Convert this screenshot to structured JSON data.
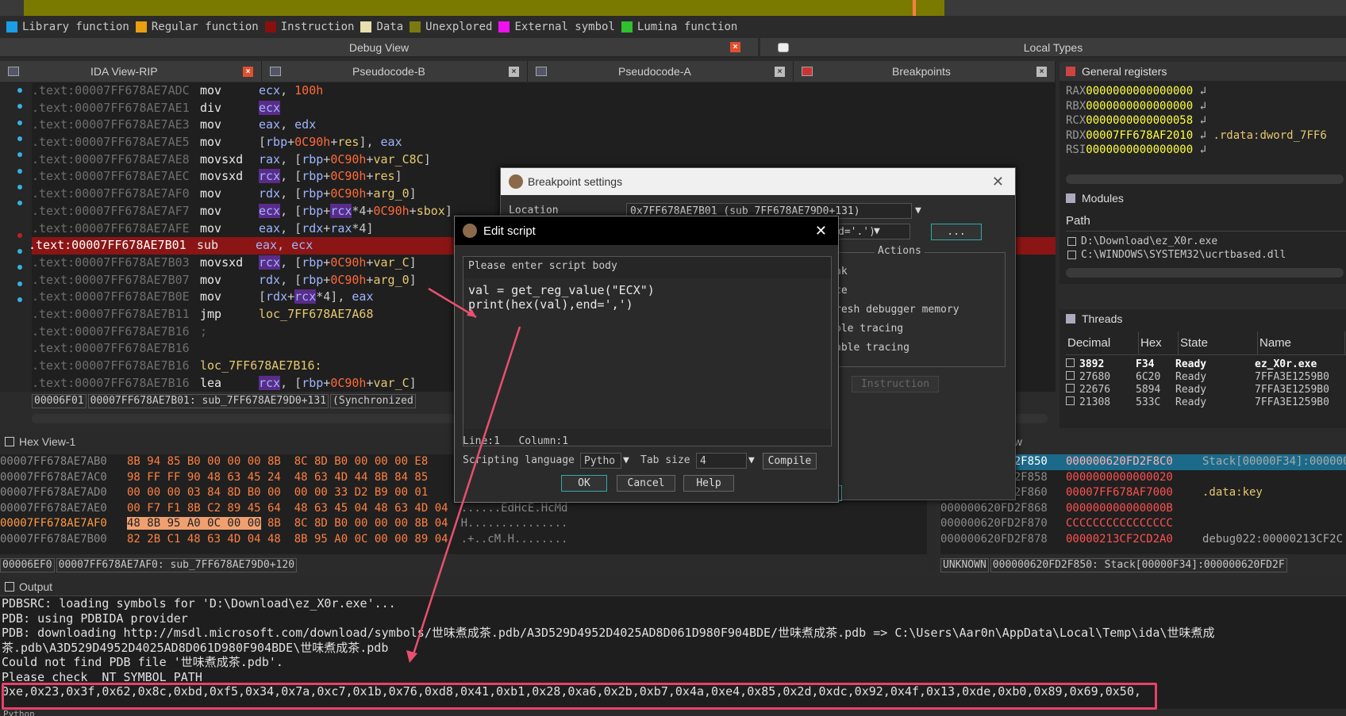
{
  "legend": [
    {
      "label": "Library function",
      "color": "#1a9ee8"
    },
    {
      "label": "Regular function",
      "color": "#e8a010"
    },
    {
      "label": "Instruction",
      "color": "#8a1010"
    },
    {
      "label": "Data",
      "color": "#e8e0b0"
    },
    {
      "label": "Unexplored",
      "color": "#7a7a10"
    },
    {
      "label": "External symbol",
      "color": "#f010f0"
    },
    {
      "label": "Lumina function",
      "color": "#30c030"
    }
  ],
  "panels": {
    "debug_view": "Debug View",
    "local_types": "Local Types",
    "tabs": [
      "IDA View-RIP",
      "Pseudocode-B",
      "Pseudocode-A",
      "Breakpoints"
    ],
    "general_registers": "General registers",
    "modules": "Modules",
    "modules_path": "Path",
    "threads": "Threads",
    "hex_view": "Hex View-1",
    "output": "Output",
    "stack_view_suffix": "ew"
  },
  "disasm": [
    {
      "addr": ".text:00007FF678AE7ADC",
      "mn": "mov",
      "ops": [
        [
          "reg",
          "ecx"
        ],
        [
          "txt",
          ", "
        ],
        [
          "num",
          "100h"
        ]
      ]
    },
    {
      "addr": ".text:00007FF678AE7AE1",
      "mn": "div",
      "ops": [
        [
          "reghl",
          "ecx"
        ]
      ]
    },
    {
      "addr": ".text:00007FF678AE7AE3",
      "mn": "mov",
      "ops": [
        [
          "reg",
          "eax"
        ],
        [
          "txt",
          ", "
        ],
        [
          "reg",
          "edx"
        ]
      ]
    },
    {
      "addr": ".text:00007FF678AE7AE5",
      "mn": "mov",
      "ops": [
        [
          "txt",
          "["
        ],
        [
          "reg",
          "rbp"
        ],
        [
          "txt",
          "+"
        ],
        [
          "num",
          "0C90h"
        ],
        [
          "txt",
          "+"
        ],
        [
          "ident",
          "res"
        ],
        [
          "txt",
          "], "
        ],
        [
          "reg",
          "eax"
        ]
      ]
    },
    {
      "addr": ".text:00007FF678AE7AE8",
      "mn": "movsxd",
      "ops": [
        [
          "reg",
          "rax"
        ],
        [
          "txt",
          ", ["
        ],
        [
          "reg",
          "rbp"
        ],
        [
          "txt",
          "+"
        ],
        [
          "num",
          "0C90h"
        ],
        [
          "txt",
          "+"
        ],
        [
          "ident",
          "var_C8C"
        ],
        [
          "txt",
          "]"
        ]
      ]
    },
    {
      "addr": ".text:00007FF678AE7AEC",
      "mn": "movsxd",
      "ops": [
        [
          "reghl",
          "rcx"
        ],
        [
          "txt",
          ", ["
        ],
        [
          "reg",
          "rbp"
        ],
        [
          "txt",
          "+"
        ],
        [
          "num",
          "0C90h"
        ],
        [
          "txt",
          "+"
        ],
        [
          "ident",
          "res"
        ],
        [
          "txt",
          "]"
        ]
      ]
    },
    {
      "addr": ".text:00007FF678AE7AF0",
      "mn": "mov",
      "ops": [
        [
          "reg",
          "rdx"
        ],
        [
          "txt",
          ", ["
        ],
        [
          "reg",
          "rbp"
        ],
        [
          "txt",
          "+"
        ],
        [
          "num",
          "0C90h"
        ],
        [
          "txt",
          "+"
        ],
        [
          "ident",
          "arg_0"
        ],
        [
          "txt",
          "]"
        ]
      ]
    },
    {
      "addr": ".text:00007FF678AE7AF7",
      "mn": "mov",
      "ops": [
        [
          "reghl",
          "ecx"
        ],
        [
          "txt",
          ", ["
        ],
        [
          "reg",
          "rbp"
        ],
        [
          "txt",
          "+"
        ],
        [
          "reghl",
          "rcx"
        ],
        [
          "txt",
          "*4+"
        ],
        [
          "num",
          "0C90h"
        ],
        [
          "txt",
          "+"
        ],
        [
          "ident",
          "sbox"
        ],
        [
          "txt",
          "]"
        ]
      ]
    },
    {
      "addr": ".text:00007FF678AE7AFE",
      "mn": "mov",
      "ops": [
        [
          "reg",
          "eax"
        ],
        [
          "txt",
          ", ["
        ],
        [
          "reg",
          "rdx"
        ],
        [
          "txt",
          "+"
        ],
        [
          "reg",
          "rax"
        ],
        [
          "txt",
          "*4]"
        ]
      ]
    },
    {
      "addr": ".text:00007FF678AE7B01",
      "mn": "sub",
      "ops": [
        [
          "reg",
          "eax"
        ],
        [
          "txt",
          ", "
        ],
        [
          "reg",
          "ecx"
        ]
      ],
      "hl": true
    },
    {
      "addr": ".text:00007FF678AE7B03",
      "mn": "movsxd",
      "ops": [
        [
          "reghl",
          "rcx"
        ],
        [
          "txt",
          ", ["
        ],
        [
          "reg",
          "rbp"
        ],
        [
          "txt",
          "+"
        ],
        [
          "num",
          "0C90h"
        ],
        [
          "txt",
          "+"
        ],
        [
          "ident",
          "var_C"
        ],
        [
          "txt",
          "]"
        ]
      ]
    },
    {
      "addr": ".text:00007FF678AE7B07",
      "mn": "mov",
      "ops": [
        [
          "reg",
          "rdx"
        ],
        [
          "txt",
          ", ["
        ],
        [
          "reg",
          "rbp"
        ],
        [
          "txt",
          "+"
        ],
        [
          "num",
          "0C90h"
        ],
        [
          "txt",
          "+"
        ],
        [
          "ident",
          "arg_0"
        ],
        [
          "txt",
          "]"
        ]
      ]
    },
    {
      "addr": ".text:00007FF678AE7B0E",
      "mn": "mov",
      "ops": [
        [
          "txt",
          "["
        ],
        [
          "reg",
          "rdx"
        ],
        [
          "txt",
          "+"
        ],
        [
          "reghl",
          "rcx"
        ],
        [
          "txt",
          "*4], "
        ],
        [
          "reg",
          "eax"
        ]
      ]
    },
    {
      "addr": ".text:00007FF678AE7B11",
      "mn": "jmp",
      "ops": [
        [
          "ident",
          "loc_7FF678AE7A68"
        ]
      ]
    },
    {
      "addr": ".text:00007FF678AE7B16",
      "mn": ";",
      "ops": []
    },
    {
      "addr": ".text:00007FF678AE7B16",
      "mn": "",
      "ops": []
    },
    {
      "addr": ".text:00007FF678AE7B16",
      "mn": "loc_7FF678AE7B16:",
      "ops": [],
      "label": true
    },
    {
      "addr": ".text:00007FF678AE7B16",
      "mn": "lea",
      "ops": [
        [
          "reghl",
          "rcx"
        ],
        [
          "txt",
          ", ["
        ],
        [
          "reg",
          "rbp"
        ],
        [
          "txt",
          "+"
        ],
        [
          "num",
          "0C90h"
        ],
        [
          "txt",
          "+"
        ],
        [
          "ident",
          "var_C"
        ],
        [
          "txt",
          "]"
        ]
      ]
    }
  ],
  "ida_status": [
    "00006F01",
    "00007FF678AE7B01: sub_7FF678AE79D0+131",
    "(Synchronized"
  ],
  "registers": [
    {
      "name": "RAX",
      "val": "0000000000000000",
      "extra": ""
    },
    {
      "name": "RBX",
      "val": "0000000000000000",
      "extra": ""
    },
    {
      "name": "RCX",
      "val": "0000000000000058",
      "extra": ""
    },
    {
      "name": "RDX",
      "val": "00007FF678AF2010",
      "extra": ".rdata:dword_7FF6"
    },
    {
      "name": "RSI",
      "val": "0000000000000000",
      "extra": ""
    }
  ],
  "modules_list": [
    "D:\\Download\\ez_X0r.exe",
    "C:\\WINDOWS\\SYSTEM32\\ucrtbased.dll"
  ],
  "threads_headers": [
    "Decimal",
    "Hex",
    "State",
    "Name"
  ],
  "threads_rows": [
    [
      "3892",
      "F34",
      "Ready",
      "ez_X0r.exe"
    ],
    [
      "27680",
      "6C20",
      "Ready",
      "7FFA3E1259B0"
    ],
    [
      "22676",
      "5894",
      "Ready",
      "7FFA3E1259B0"
    ],
    [
      "21308",
      "533C",
      "Ready",
      "7FFA3E1259B0"
    ]
  ],
  "hex_rows": [
    {
      "addr": "00007FF678AE7AB0",
      "bytes": "8B 94 85 B0 00 00 00 8B  8C 8D B0 00 00 00 E8",
      "ascii": ""
    },
    {
      "addr": "00007FF678AE7AC0",
      "bytes": "98 FF FF 90 48 63 45 24  48 63 4D 44 8B 84 85",
      "ascii": ""
    },
    {
      "addr": "00007FF678AE7AD0",
      "bytes": "00 00 00 03 84 8D B0 00  00 00 33 D2 B9 00 01",
      "ascii": ""
    },
    {
      "addr": "00007FF678AE7AE0",
      "bytes": "00 F7 F1 8B C2 89 45 64  48 63 45 04 48 63 4D 04",
      "ascii": "......EdHcE.HcMd"
    },
    {
      "addr": "00007FF678AE7AF0",
      "bytes": "48 8B 95 A0 0C 00 00",
      "bytes2": " 8B  8C 8D B0 00 00 00 8B 04",
      "ascii": "H..............."
    },
    {
      "addr": "00007FF678AE7B00",
      "bytes": "82 2B C1 48 63 4D 04 48  8B 95 A0 0C 00 00 89 04",
      "ascii": ".+..cM.H........"
    }
  ],
  "hex_status": [
    "00006EF0",
    "00007FF678AE7AF0: sub_7FF678AE79D0+120"
  ],
  "stack_rows": [
    {
      "addr": "000000620FD2F850",
      "val": "000000620FD2F8C0",
      "note": "Stack[00000F34]:000000"
    },
    {
      "addr": "000000620FD2F858",
      "val": "0000000000000020",
      "note": ""
    },
    {
      "addr": "000000620FD2F860",
      "val": "00007FF678AF7000",
      "note": ".data:key"
    },
    {
      "addr": "000000620FD2F868",
      "val": "000000000000000B",
      "note": ""
    },
    {
      "addr": "000000620FD2F870",
      "val": "CCCCCCCCCCCCCCCC",
      "note": ""
    },
    {
      "addr": "000000620FD2F878",
      "val": "00000213CF2CD2A0",
      "note": "debug022:00000213CF2C"
    }
  ],
  "stack_status": [
    "UNKNOWN",
    "000000620FD2F850: Stack[00000F34]:000000620FD2F"
  ],
  "output_lines": [
    "PDBSRC: loading symbols for 'D:\\Download\\ez_X0r.exe'...",
    "PDB: using PDBIDA provider",
    "PDB: downloading http://msdl.microsoft.com/download/symbols/世味煮成茶.pdb/A3D529D4952D4025AD8D061D980F904BDE/世味煮成茶.pdb => C:\\Users\\Aar0n\\AppData\\Local\\Temp\\ida\\世味煮成",
    "茶.pdb\\A3D529D4952D4025AD8D061D980F904BDE\\世味煮成茶.pdb",
    "Could not find PDB file '世味煮成茶.pdb'.",
    "Please check _NT_SYMBOL_PATH",
    "0xe,0x23,0x3f,0x62,0x8c,0xbd,0xf5,0x34,0x7a,0xc7,0x1b,0x76,0xd8,0x41,0xb1,0x28,0xa6,0x2b,0xb7,0x4a,0xe4,0x85,0x2d,0xdc,0x92,0x4f,0x13,0xde,0xb0,0x89,0x69,0x50,"
  ],
  "output_prompt": "Python",
  "bp_dialog": {
    "title": "Breakpoint settings",
    "location_label": "Location",
    "location_value": "0x7FF678AE7B01 (sub_7FF678AE79D0+131)",
    "condition_tail": "d='.')",
    "more_button": "...",
    "actions_label": "Actions",
    "actions": [
      "ak",
      "ce",
      "resh debugger memory",
      "ble tracing",
      "able tracing"
    ],
    "instruction_button": "Instruction"
  },
  "script_dialog": {
    "title": "Edit script",
    "prompt": "Please enter script body",
    "code": [
      "val = get_reg_value(\"ECX\")",
      "print(hex(val),end=',')"
    ],
    "status": "Line:1   Column:1",
    "lang_label": "Scripting language",
    "lang_value": "Pytho",
    "tab_label": "Tab size",
    "tab_value": "4",
    "compile": "Compile",
    "ok": "OK",
    "cancel": "Cancel",
    "help": "Help"
  }
}
